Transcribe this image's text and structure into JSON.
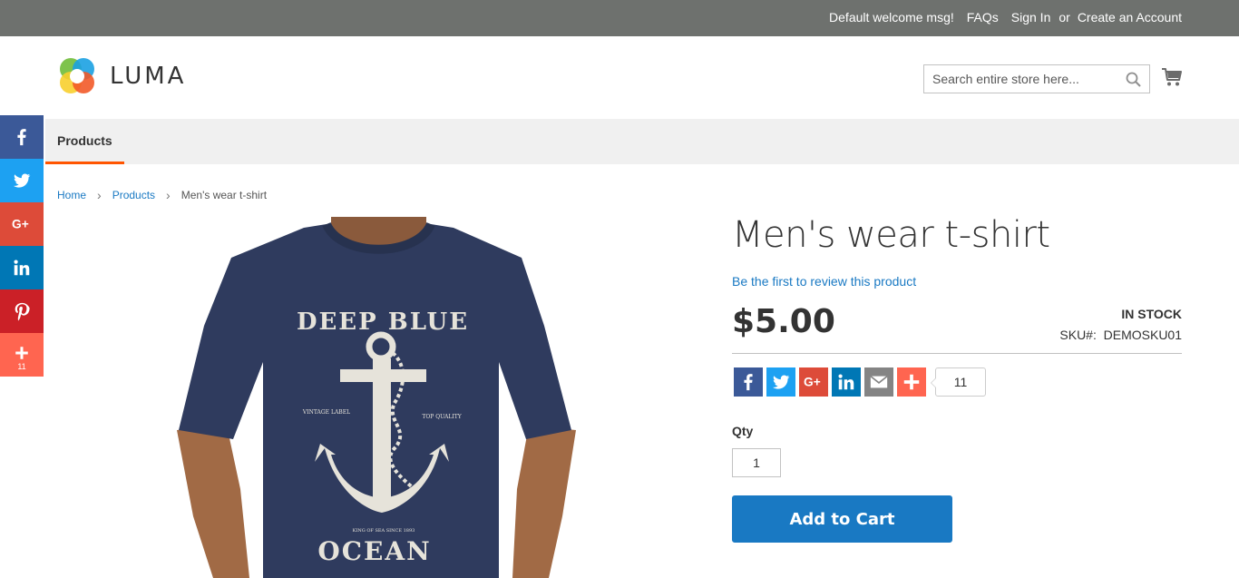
{
  "topbar": {
    "welcome": "Default welcome msg!",
    "faqs": "FAQs",
    "sign_in": "Sign In",
    "or": "or",
    "create_account": "Create an Account"
  },
  "header": {
    "logo_text": "LUMA",
    "search_placeholder": "Search entire store here..."
  },
  "nav": {
    "items": [
      {
        "label": "Products"
      }
    ]
  },
  "social_sidebar": {
    "items": [
      {
        "name": "facebook",
        "icon": "facebook-icon",
        "color": "#3b5998"
      },
      {
        "name": "twitter",
        "icon": "twitter-icon",
        "color": "#1da1f2"
      },
      {
        "name": "google-plus",
        "icon": "google-plus-icon",
        "color": "#dd4b39"
      },
      {
        "name": "linkedin",
        "icon": "linkedin-icon",
        "color": "#0077b5"
      },
      {
        "name": "pinterest",
        "icon": "pinterest-icon",
        "color": "#cb2027"
      },
      {
        "name": "more",
        "icon": "plus-icon",
        "color": "#ff6550",
        "count": "11"
      }
    ]
  },
  "breadcrumb": {
    "home": "Home",
    "products": "Products",
    "current": "Men's wear t-shirt"
  },
  "product": {
    "title": "Men's wear t-shirt",
    "review_link": "Be the first to review this product",
    "price": "$5.00",
    "stock": "In stock",
    "sku_label": "SKU#:",
    "sku_value": "DEMOSKU01",
    "image_text": {
      "top": "DEEP BLUE",
      "bottom": "OCEAN",
      "left_small": "VINTAGE LABEL",
      "right_small": "TOP QUALITY",
      "tagline": "KING OF SEA SINCE 1893"
    },
    "share_count": "11",
    "qty_label": "Qty",
    "qty_value": "1",
    "add_to_cart": "Add to Cart"
  },
  "colors": {
    "topbar": "#6e716e",
    "accent": "#1979c3",
    "nav_underline": "#ff5501",
    "shirt": "#2f3b5e"
  }
}
